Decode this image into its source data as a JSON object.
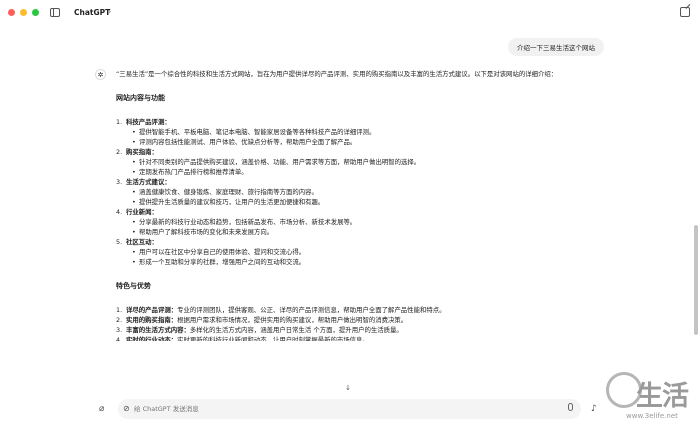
{
  "window": {
    "app_title": "ChatGPT",
    "chevron": "›"
  },
  "user_message": "介绍一下三易生活这个网站",
  "answer": {
    "intro": "“三易生活”是一个综合性的科技和生活方式网站，旨在为用户提供详尽的产品评测、实用的购买指南以及丰富的生活方式建议。以下是对该网站的详细介绍：",
    "heading_content": "网站内容与功能",
    "sections": [
      {
        "num": "1.",
        "title": "科技产品评测：",
        "bullets": [
          "提供智能手机、平板电脑、笔记本电脑、智能家居设备等各种科技产品的详细评测。",
          "评测内容包括性能测试、用户体验、优缺点分析等，帮助用户全面了解产品。"
        ]
      },
      {
        "num": "2.",
        "title": "购买指南：",
        "bullets": [
          "针对不同类别的产品提供购买建议，涵盖价格、功能、用户需求等方面，帮助用户做出明智的选择。",
          "定期发布热门产品排行榜和推荐清单。"
        ]
      },
      {
        "num": "3.",
        "title": "生活方式建议：",
        "bullets": [
          "涵盖健康饮食、健身锻炼、家庭理财、旅行指南等方面的内容。",
          "提供提升生活质量的建议和技巧，让用户的生活更加便捷和有趣。"
        ]
      },
      {
        "num": "4.",
        "title": "行业新闻：",
        "bullets": [
          "分享最新的科技行业动态和趋势，包括新品发布、市场分析、新技术发展等。",
          "帮助用户了解科技市场的变化和未来发展方向。"
        ]
      },
      {
        "num": "5.",
        "title": "社区互动：",
        "bullets": [
          "用户可以在社区中分享自己的使用体验、提问和交流心得。",
          "形成一个互助和分享的社群，增强用户之间的互动和交流。"
        ]
      }
    ],
    "heading_features": "特色与优势",
    "features": [
      {
        "num": "1.",
        "title": "详尽的产品评测：",
        "text": "专业的评测团队，提供客观、公正、详尽的产品评测信息，帮助用户全面了解产品性能和特点。"
      },
      {
        "num": "2.",
        "title": "实用的购买指南：",
        "text": "根据用户需求和市场情况，提供实用的购买建议，帮助用户做出明智的消费决策。"
      },
      {
        "num": "3.",
        "title": "丰富的生活方式内容：",
        "text": "多样化的生活方式内容，涵盖用户日常生活     个方面，提升用户的生活质量。"
      },
      {
        "num": "4.",
        "title": "实时的行业动态：",
        "text": "实时更新的科技行业新闻和动态，让用户时刻掌握最新的市场信息。"
      }
    ]
  },
  "composer": {
    "placeholder": "给 ChatGPT 发送消息"
  },
  "icons": {
    "avatar": "✲",
    "attach": "⌀",
    "voice": "♪",
    "scroll_down": "↓",
    "composer_lead": "⊘"
  },
  "watermark": {
    "text": "生活",
    "url": "www.3elife.net"
  }
}
